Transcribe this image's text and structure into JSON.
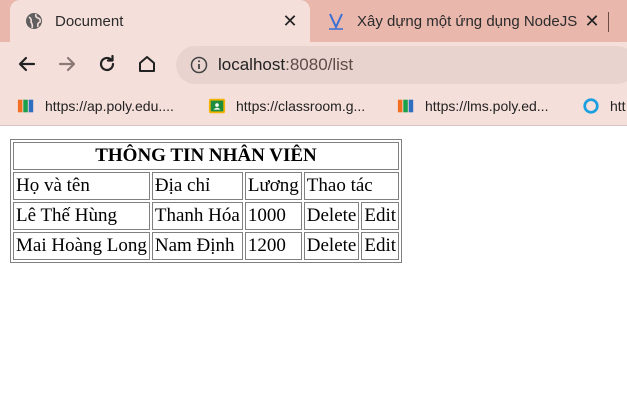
{
  "browser": {
    "tabs": [
      {
        "title": "Document",
        "active": true,
        "icon": "globe-icon"
      },
      {
        "title": "Xây dựng một ứng dụng NodeJS",
        "active": false,
        "icon": "v-logo-icon"
      }
    ],
    "close_symbol": "✕",
    "url_host": "localhost",
    "url_rest": ":8080/list",
    "bookmarks": [
      {
        "label": "https://ap.poly.edu....",
        "icon": "fpt-icon"
      },
      {
        "label": "https://classroom.g...",
        "icon": "classroom-icon"
      },
      {
        "label": "https://lms.poly.ed...",
        "icon": "fpt-icon"
      },
      {
        "label": "htt",
        "icon": "ring-icon"
      }
    ]
  },
  "table": {
    "caption": "THÔNG TIN NHÂN VIÊN",
    "headers": [
      "Họ và tên",
      "Địa chỉ",
      "Lương",
      "Thao tác"
    ],
    "rows": [
      {
        "name": "Lê Thế Hùng",
        "address": "Thanh Hóa",
        "salary": "1000",
        "delete": "Delete",
        "edit": "Edit"
      },
      {
        "name": "Mai Hoàng Long",
        "address": "Nam Định",
        "salary": "1200",
        "delete": "Delete",
        "edit": "Edit"
      }
    ]
  },
  "colors": {
    "tabstrip": "#e9b7ac",
    "toolbar": "#f5dfda",
    "omnibox": "#e8d3cf"
  }
}
